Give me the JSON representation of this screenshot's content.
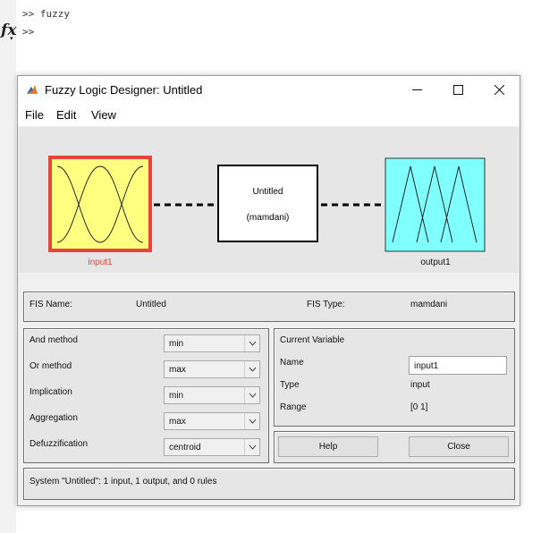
{
  "command_window": {
    "line1": ">> fuzzy",
    "line2": ">>",
    "fx": "fx"
  },
  "window": {
    "title": "Fuzzy Logic Designer: Untitled",
    "controls": {
      "minimize": "minimize-icon",
      "maximize": "maximize-icon",
      "close": "close-icon"
    }
  },
  "menu": [
    "File",
    "Edit",
    "View"
  ],
  "diagram": {
    "input_label": "input1",
    "system_name": "Untitled",
    "system_type": "(mamdani)",
    "output_label": "output1",
    "colors": {
      "input_fill": "#ffff80",
      "input_border": "#e8443a",
      "output_fill": "#80ffff"
    }
  },
  "fis_info": {
    "name_label": "FIS Name:",
    "name_value": "Untitled",
    "type_label": "FIS Type:",
    "type_value": "mamdani"
  },
  "methods": [
    {
      "label": "And method",
      "value": "min"
    },
    {
      "label": "Or method",
      "value": "max"
    },
    {
      "label": "Implication",
      "value": "min"
    },
    {
      "label": "Aggregation",
      "value": "max"
    },
    {
      "label": "Defuzzification",
      "value": "centroid"
    }
  ],
  "current_variable": {
    "heading": "Current Variable",
    "name_label": "Name",
    "name_value": "input1",
    "type_label": "Type",
    "type_value": "input",
    "range_label": "Range",
    "range_value": "[0 1]"
  },
  "buttons": {
    "help": "Help",
    "close": "Close"
  },
  "status": "System \"Untitled\": 1 input, 1 output, and 0 rules"
}
